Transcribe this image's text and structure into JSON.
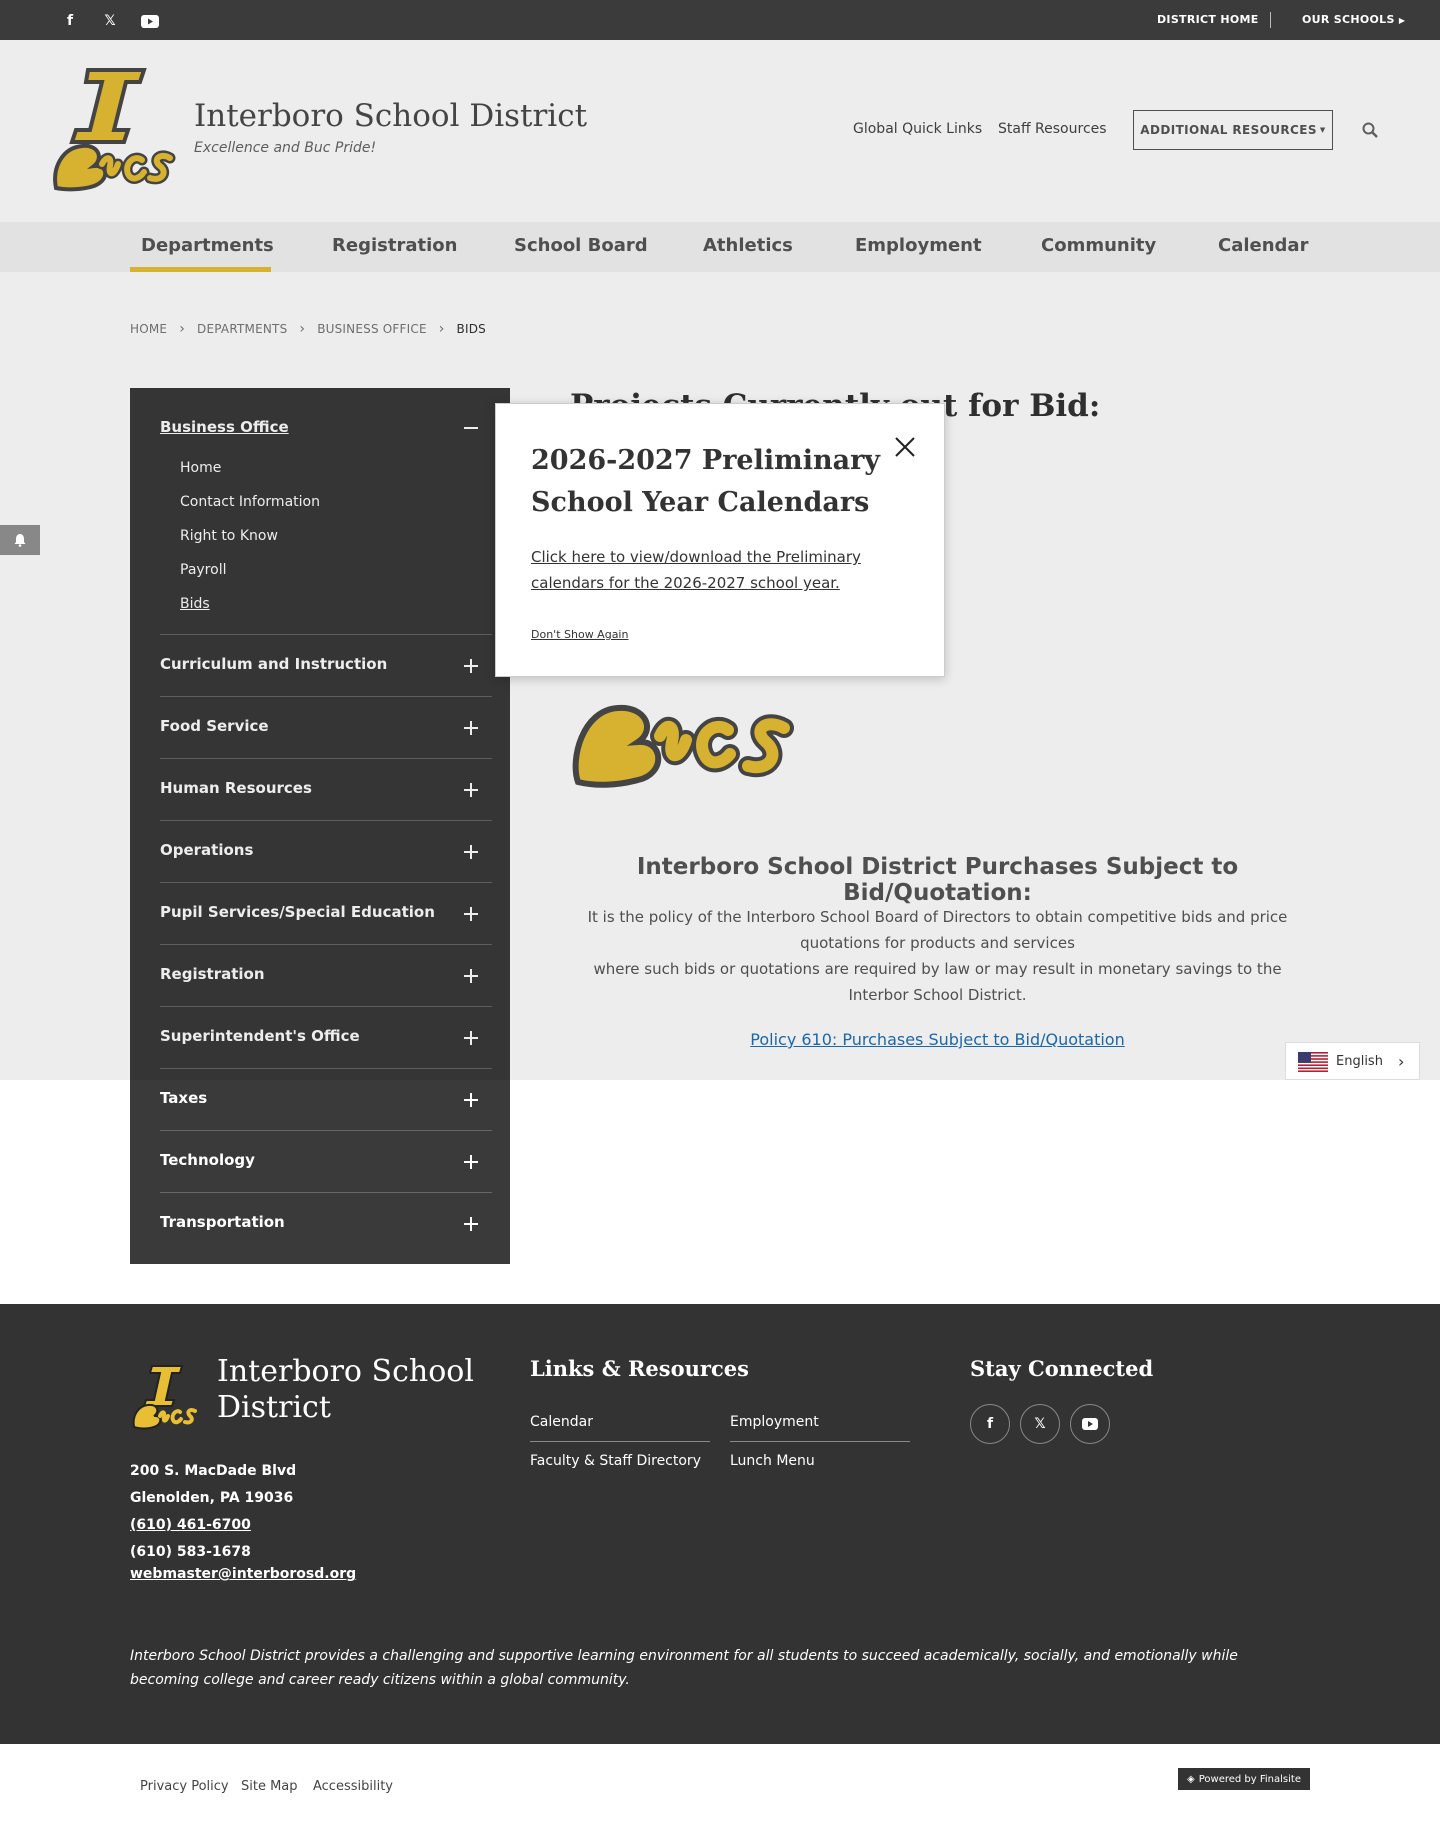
{
  "topbar": {
    "social": [
      "facebook-icon",
      "x-icon",
      "youtube-icon"
    ],
    "district_home": "DISTRICT HOME",
    "our_schools": "OUR SCHOOLS"
  },
  "header": {
    "logo_alt": "I Bucs",
    "title": "Interboro School District",
    "tagline": "Excellence and Buc Pride!",
    "global_quick_links": "Global Quick Links",
    "staff_resources": "Staff Resources",
    "additional_resources": "ADDITIONAL RESOURCES"
  },
  "nav": {
    "items": [
      "Departments",
      "Registration",
      "School Board",
      "Athletics",
      "Employment",
      "Community",
      "Calendar"
    ],
    "active": "Departments"
  },
  "breadcrumb": [
    "HOME",
    "DEPARTMENTS",
    "BUSINESS OFFICE",
    "BIDS"
  ],
  "sidebar": {
    "heading": "Business Office",
    "subitems": [
      "Home",
      "Contact Information",
      "Right to Know",
      "Payroll",
      "Bids"
    ],
    "active_subitem": "Bids",
    "sections": [
      "Curriculum and Instruction",
      "Food Service",
      "Human Resources",
      "Operations",
      "Pupil Services/Special Education",
      "Registration",
      "Superintendent's Office",
      "Taxes",
      "Technology",
      "Transportation"
    ]
  },
  "main": {
    "heading": "Projects Currently out for Bid:",
    "sub_heading": "Interboro School District Purchases Subject to Bid/Quotation:",
    "para1": "It is the policy of the Interboro School Board of Directors to obtain competitive bids and price quotations for products and services",
    "para2": "where such bids or quotations are required by law or may result in monetary savings to the Interbor School District.",
    "policy_link": "Policy 610: Purchases Subject to Bid/Quotation"
  },
  "modal": {
    "title": "2026-2027 Preliminary School Year Calendars",
    "link": "Click here to view/download the Preliminary calendars for the 2026-2027 school year.",
    "dont_show": "Don't Show Again"
  },
  "language": {
    "current": "English"
  },
  "footer": {
    "title": "Interboro School District",
    "address1": "200 S. MacDade Blvd",
    "address2": "Glenolden, PA  19036",
    "phone": "(610) 461-6700",
    "fax": "(610) 583-1678",
    "email": "webmaster@interborosd.org",
    "links_heading": "Links & Resources",
    "links": [
      "Calendar",
      "Employment",
      "Faculty & Staff Directory",
      "Lunch Menu"
    ],
    "connected_heading": "Stay Connected",
    "mission": "Interboro School District provides a challenging and supportive learning environment for all students to succeed academically, socially, and emotionally while becoming college and career ready citizens within a global community."
  },
  "bottom": {
    "links": [
      "Privacy Policy",
      "Site Map",
      "Accessibility"
    ],
    "powered": "Powered by Finalsite"
  },
  "colors": {
    "accent": "#e8bf34",
    "dark": "#3a3a3a",
    "link": "#1f6fb2"
  }
}
